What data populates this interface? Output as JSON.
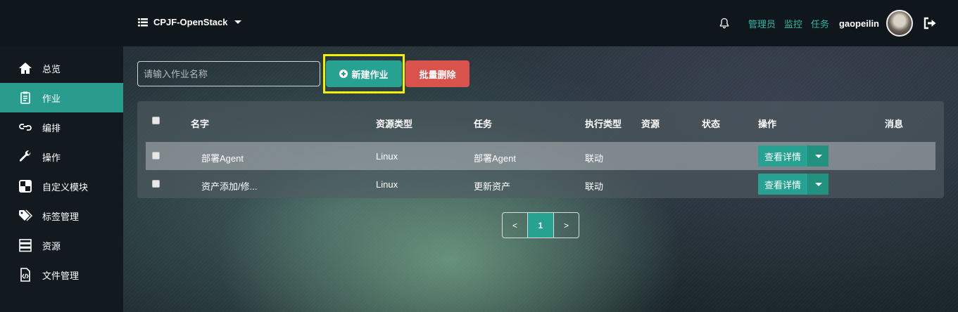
{
  "header": {
    "project": "CPJF-OpenStack",
    "links": [
      "管理员",
      "监控",
      "任务"
    ],
    "username": "gaopeilin"
  },
  "sidebar": {
    "items": [
      {
        "label": "总览",
        "icon": "home-icon"
      },
      {
        "label": "作业",
        "icon": "clipboard-icon",
        "active": true
      },
      {
        "label": "编排",
        "icon": "link-icon"
      },
      {
        "label": "操作",
        "icon": "wrench-icon"
      },
      {
        "label": "自定义模块",
        "icon": "checker-icon"
      },
      {
        "label": "标签管理",
        "icon": "tags-icon"
      },
      {
        "label": "资源",
        "icon": "server-icon"
      },
      {
        "label": "文件管理",
        "icon": "file-code-icon"
      }
    ]
  },
  "toolbar": {
    "search_placeholder": "请输入作业名称",
    "new_label": "新建作业",
    "delete_label": "批量删除"
  },
  "table": {
    "headers": [
      "名字",
      "资源类型",
      "任务",
      "执行类型",
      "资源",
      "状态",
      "操作",
      "消息"
    ],
    "rows": [
      {
        "name": "部署Agent",
        "resource_type": "Linux",
        "task": "部署Agent",
        "exec_type": "联动",
        "resource": "",
        "status": "",
        "action": "查看详情",
        "message": ""
      },
      {
        "name": "资产添加/修...",
        "resource_type": "Linux",
        "task": "更新资产",
        "exec_type": "联动",
        "resource": "",
        "status": "",
        "action": "查看详情",
        "message": ""
      }
    ]
  },
  "pagination": {
    "prev": "<",
    "current": "1",
    "next": ">"
  },
  "colors": {
    "accent": "#27a292",
    "danger": "#d9524c",
    "highlight": "#f2f200"
  }
}
